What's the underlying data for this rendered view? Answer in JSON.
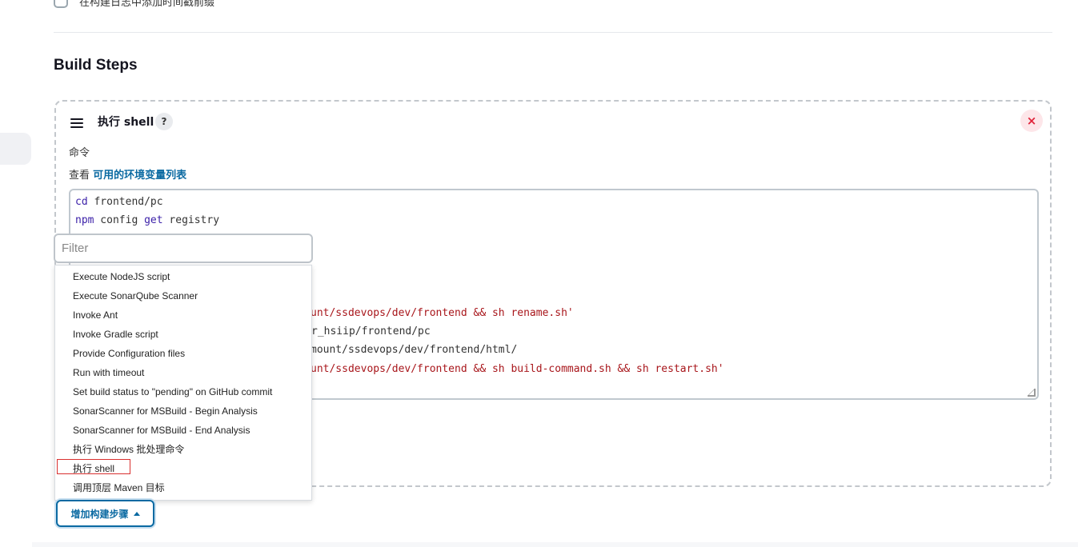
{
  "top_checkbox": {
    "label": "在构建日志中添加时间戳前缀",
    "checked": false
  },
  "section": {
    "title": "Build Steps"
  },
  "step": {
    "title": "执行 shell",
    "help_label": "?",
    "close_label": "×",
    "command_label": "命令",
    "env_prefix": "查看",
    "env_link": "可用的环境变量列表"
  },
  "editor": {
    "visible_lines": [
      {
        "kw": "cd",
        "rest": " frontend/pc"
      },
      {
        "kw": "npm",
        "rest": " config ",
        "kw2": "get",
        "rest2": " registry"
      }
    ],
    "partial_lines": [
      {
        "plain": "",
        "str": "unt/ssdevops/dev/frontend && sh rename.sh'"
      },
      {
        "plain": "r_hsiip/frontend/pc",
        "str": ""
      },
      {
        "plain": "mount/ssdevops/dev/frontend/html/",
        "str": ""
      },
      {
        "plain": "",
        "str": "unt/ssdevops/dev/frontend && sh build-command.sh && sh restart.sh'"
      }
    ]
  },
  "filter": {
    "placeholder": "Filter"
  },
  "dropdown": {
    "items": [
      "Execute NodeJS script",
      "Execute SonarQube Scanner",
      "Invoke Ant",
      "Invoke Gradle script",
      "Provide Configuration files",
      "Run with timeout",
      "Set build status to \"pending\" on GitHub commit",
      "SonarScanner for MSBuild - Begin Analysis",
      "SonarScanner for MSBuild - End Analysis",
      "执行 Windows 批处理命令",
      "执行 shell",
      "调用顶层 Maven 目标"
    ],
    "highlighted": "执行 shell"
  },
  "add_step_button": {
    "label": "增加构建步骤"
  },
  "colors": {
    "accent": "#0b6aa2",
    "danger": "#e0243a",
    "highlight": "#d9302f"
  }
}
